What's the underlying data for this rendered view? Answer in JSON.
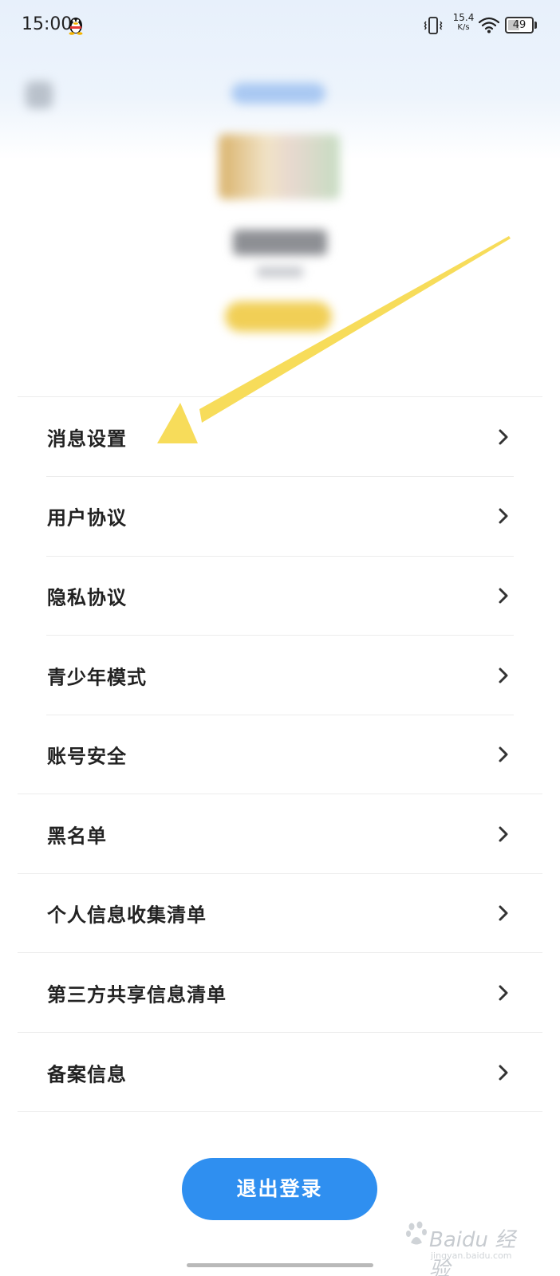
{
  "status_bar": {
    "time": "15:00",
    "network_speed": "15.4",
    "network_speed_unit": "K/s",
    "battery_level": "49",
    "battery_fraction": 0.49
  },
  "icons": {
    "qq": "qq-penguin-icon",
    "vibrate": "vibrate-icon",
    "wifi": "wifi-icon",
    "back": "back-arrow-icon",
    "chevron": "chevron-right-icon"
  },
  "menu": {
    "items": [
      {
        "label": "消息设置"
      },
      {
        "label": "用户协议"
      },
      {
        "label": "隐私协议"
      },
      {
        "label": "青少年模式"
      },
      {
        "label": "账号安全"
      },
      {
        "label": "黑名单"
      },
      {
        "label": "个人信息收集清单"
      },
      {
        "label": "第三方共享信息清单"
      },
      {
        "label": "备案信息"
      }
    ]
  },
  "logout": {
    "label": "退出登录"
  },
  "watermark": {
    "brand": "Baidu 经验",
    "url": "jingyan.baidu.com"
  },
  "colors": {
    "accent": "#2f8ff0",
    "annotation_arrow": "#f7dc5a",
    "header_tint": "#e7f0fb",
    "divider": "#ececec"
  }
}
